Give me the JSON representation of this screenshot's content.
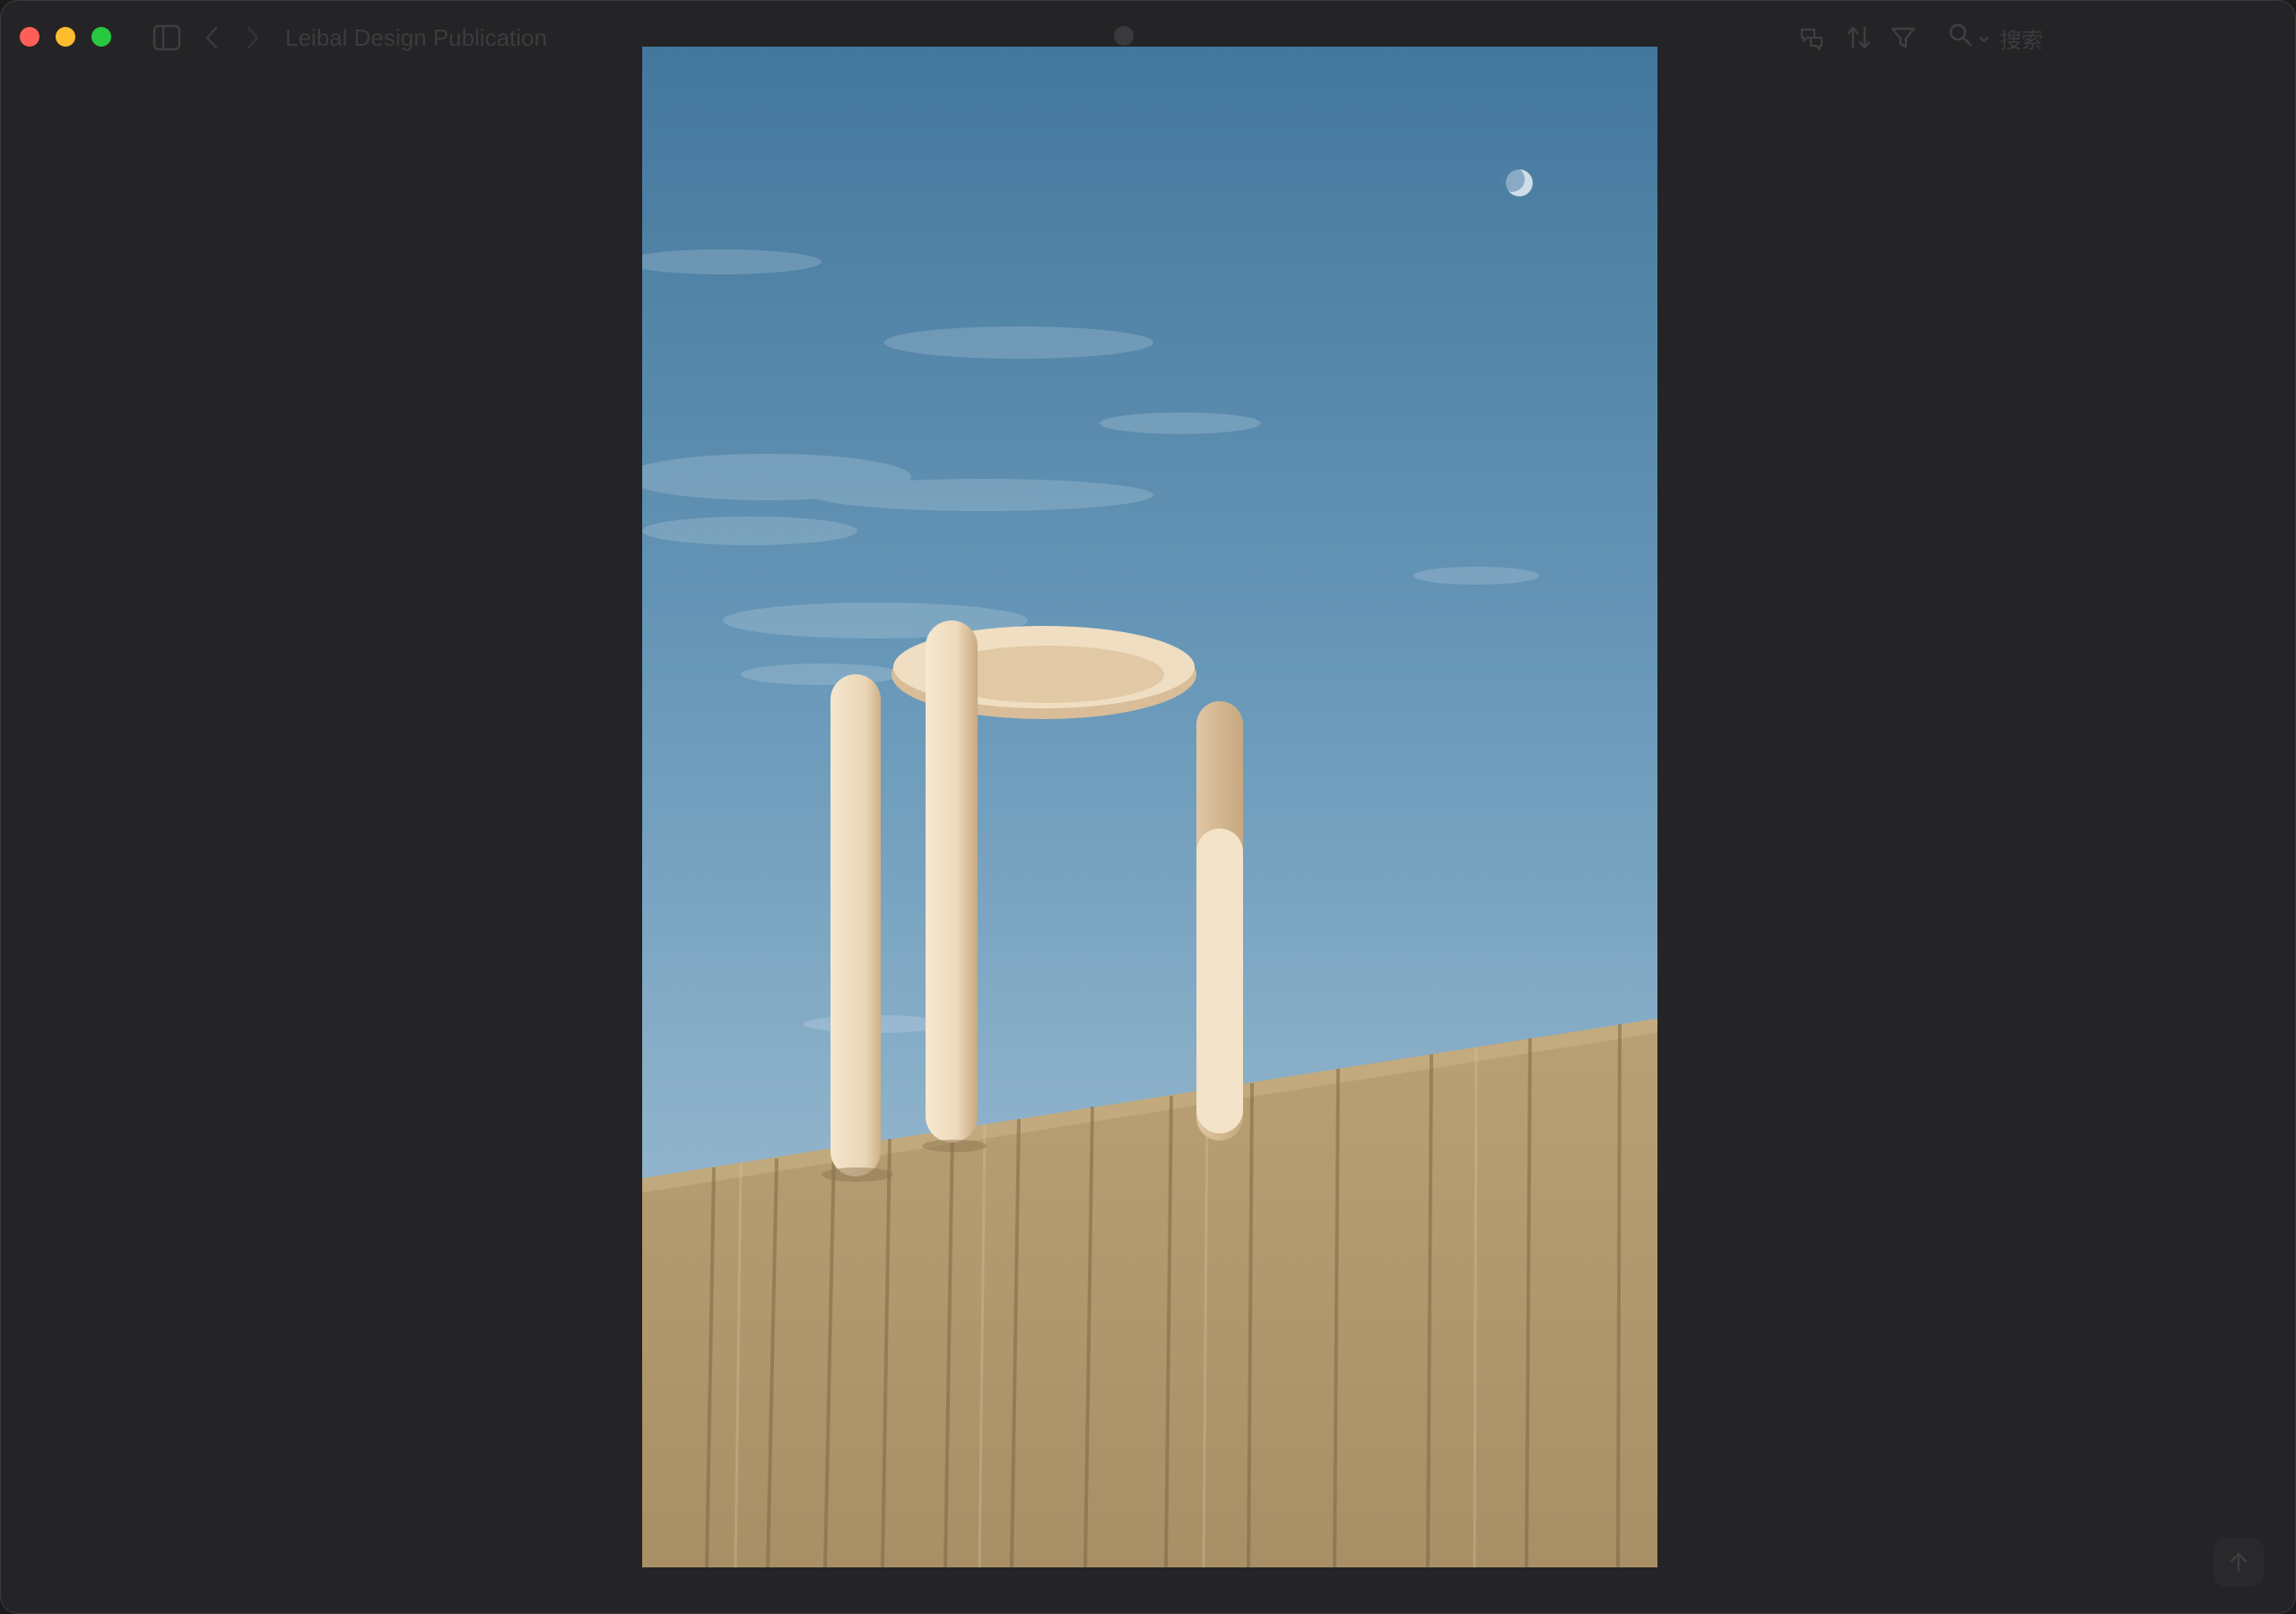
{
  "window": {
    "title": "Leibal Design Publication"
  },
  "toolbar": {
    "search_placeholder": "搜索",
    "icons": [
      "sidebar-toggle-icon",
      "back-chevron-icon",
      "forward-chevron-icon",
      "translate-icon",
      "sort-icon",
      "filter-icon",
      "search-icon",
      "chevron-down-icon"
    ]
  },
  "photo": {
    "subject": "cream tubular stool on concrete wall against blue sky with moon"
  },
  "colors": {
    "window_bg": "#242426",
    "sky_top": "#4a7fa3",
    "sky_bottom": "#a9c6da",
    "stool": "#efdcc0",
    "concrete": "#b39a70"
  }
}
